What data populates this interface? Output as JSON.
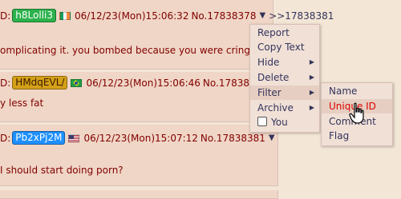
{
  "posts": [
    {
      "id_prefix": "D:",
      "poster_id": "h8Lolli3",
      "id_bg": "#2bb24c",
      "country_flag": "ireland-flag-icon",
      "datetime": "06/12/23(Mon)15:06:32",
      "number": "No.17838378",
      "reply_link": ">>17838381",
      "text": "omplicating it. you bombed because you were cringe."
    },
    {
      "id_prefix": "D:",
      "poster_id": "HMdqEVL/",
      "id_bg": "#d4a017",
      "country_flag": "brazil-flag-icon",
      "datetime": "06/12/23(Mon)15:06:46",
      "number": "No.178383",
      "text": "y less fat"
    },
    {
      "id_prefix": "D:",
      "poster_id": "Pb2xPj2M",
      "id_bg": "#1e90ff",
      "country_flag": "usa-flag-icon",
      "datetime": "06/12/23(Mon)15:07:12",
      "number": "No.17838381",
      "text": "I should start doing porn?"
    }
  ],
  "context_menu": {
    "items": [
      "Report",
      "Copy Text",
      "Hide",
      "Delete",
      "Filter",
      "Archive",
      "You"
    ],
    "highlighted": "Filter"
  },
  "filter_submenu": {
    "items": [
      "Name",
      "Unique ID",
      "Comment",
      "Flag"
    ],
    "active": "Unique ID"
  }
}
